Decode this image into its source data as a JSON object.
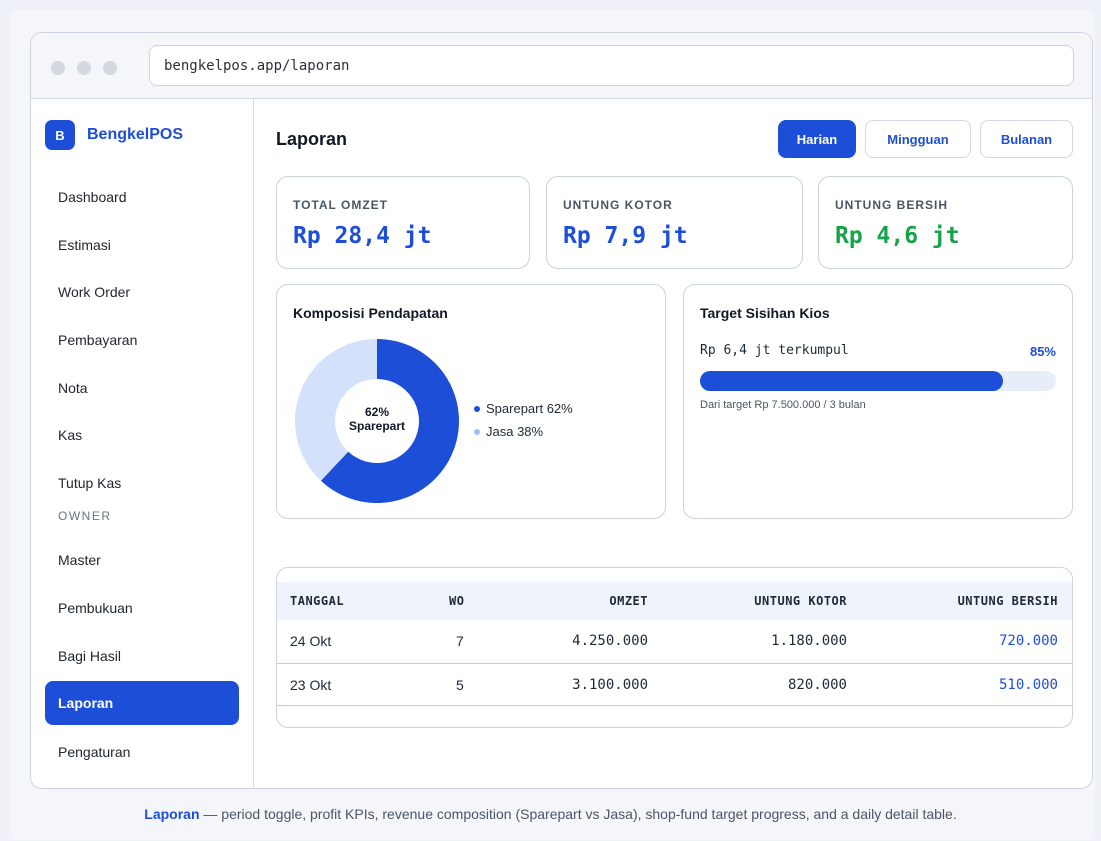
{
  "browser": {
    "url": "bengkelpos.app/laporan"
  },
  "sidebar": {
    "brand_logo": "B",
    "brand_name": "BengkelPOS",
    "items": [
      "Dashboard",
      "Estimasi",
      "Work Order",
      "Pembayaran",
      "Nota",
      "Kas",
      "Tutup Kas"
    ],
    "section_label": "OWNER",
    "owner_items": [
      "Master",
      "Pembukuan",
      "Bagi Hasil",
      "Laporan",
      "Pengaturan"
    ],
    "active_item": "Laporan"
  },
  "header": {
    "title": "Laporan",
    "periods": [
      "Harian",
      "Mingguan",
      "Bulanan"
    ],
    "active_period": "Harian"
  },
  "kpis": [
    {
      "label": "TOTAL OMZET",
      "value": "Rp 28,4 jt",
      "color": "#1d4ed8"
    },
    {
      "label": "UNTUNG KOTOR",
      "value": "Rp 7,9 jt",
      "color": "#1d4ed8"
    },
    {
      "label": "UNTUNG BERSIH",
      "value": "Rp 4,6 jt",
      "color": "#16a34a"
    }
  ],
  "composition": {
    "title": "Komposisi Pendapatan",
    "center_line1": "62%",
    "center_line2": "Sparepart",
    "legend": [
      "Sparepart 62%",
      "Jasa 38%"
    ],
    "chart_data": {
      "type": "pie",
      "categories": [
        "Sparepart",
        "Jasa"
      ],
      "values": [
        62,
        38
      ],
      "colors": [
        "#1d4ed8",
        "#d3e1fb"
      ]
    }
  },
  "target": {
    "title": "Target Sisihan Kios",
    "collected": "Rp 6,4 jt terkumpul",
    "percent_label": "85%",
    "percent": 85,
    "note": "Dari target Rp 7.500.000 / 3 bulan"
  },
  "table": {
    "headers": [
      "TANGGAL",
      "WO",
      "OMZET",
      "UNTUNG KOTOR",
      "UNTUNG BERSIH"
    ],
    "rows": [
      [
        "24 Okt",
        "7",
        "4.250.000",
        "1.180.000",
        "720.000"
      ],
      [
        "23 Okt",
        "5",
        "3.100.000",
        "820.000",
        "510.000"
      ]
    ]
  },
  "caption": {
    "title": "Laporan",
    "text": " — period toggle, profit KPIs, revenue composition (Sparepart vs Jasa), shop-fund target progress, and a daily detail table."
  }
}
